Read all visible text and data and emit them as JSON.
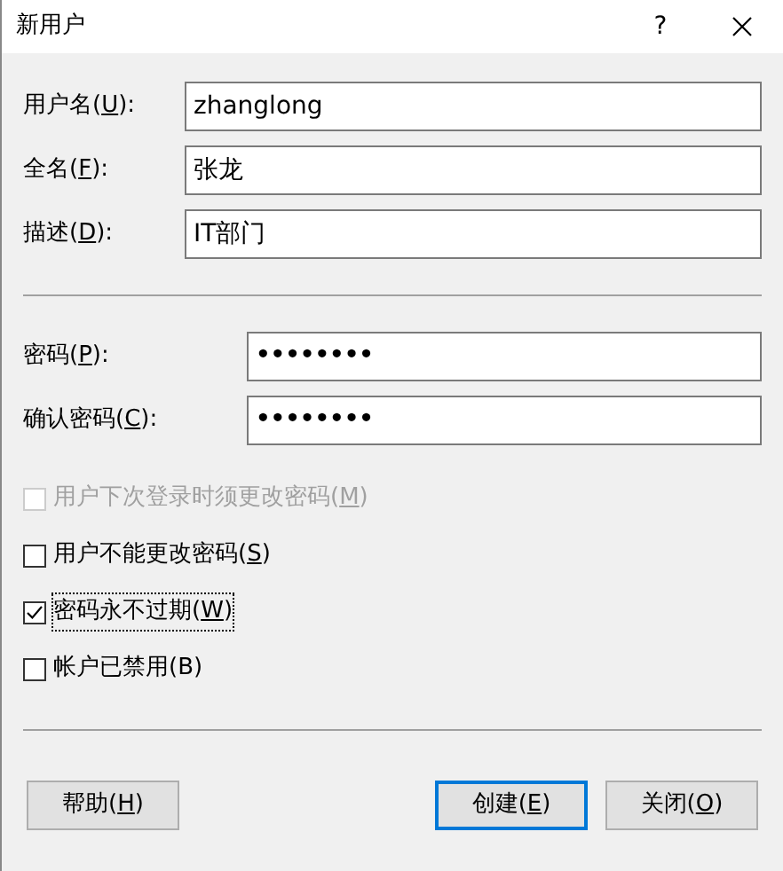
{
  "window": {
    "title": "新用户",
    "help": "?"
  },
  "fields": [
    {
      "label": {
        "pre": "用户名(",
        "key": "U",
        "post": "):"
      },
      "value": "zhanglong",
      "kind": "text"
    },
    {
      "label": {
        "pre": "全名(",
        "key": "F",
        "post": "):"
      },
      "value": "张龙",
      "kind": "text"
    },
    {
      "label": {
        "pre": "描述(",
        "key": "D",
        "post": "):"
      },
      "value": "IT部门",
      "kind": "text"
    }
  ],
  "passwords": [
    {
      "label": {
        "pre": "密码(",
        "key": "P",
        "post": "):"
      },
      "value": "••••••••",
      "kind": "password"
    },
    {
      "label": {
        "pre": "确认密码(",
        "key": "C",
        "post": "):"
      },
      "value": "••••••••",
      "kind": "password"
    }
  ],
  "checkboxes": [
    {
      "label": {
        "pre": "用户下次登录时须更改密码(",
        "key": "M",
        "post": ")"
      },
      "checked": false,
      "disabled": true,
      "focused": false
    },
    {
      "label": {
        "pre": "用户不能更改密码(",
        "key": "S",
        "post": ")"
      },
      "checked": false,
      "disabled": false,
      "focused": false
    },
    {
      "label": {
        "pre": "密码永不过期(",
        "key": "W",
        "post": ")"
      },
      "checked": true,
      "disabled": false,
      "focused": true
    },
    {
      "label": {
        "pre": "帐户已禁用(B)"
      },
      "checked": false,
      "disabled": false,
      "focused": false
    }
  ],
  "buttons": [
    {
      "label": {
        "pre": "帮助(",
        "key": "H",
        "post": ")"
      },
      "default": false
    },
    {
      "label": {
        "pre": "创建(",
        "key": "E",
        "post": ")"
      },
      "default": true
    },
    {
      "label": {
        "pre": "关闭(",
        "key": "O",
        "post": ")"
      },
      "default": false
    }
  ]
}
